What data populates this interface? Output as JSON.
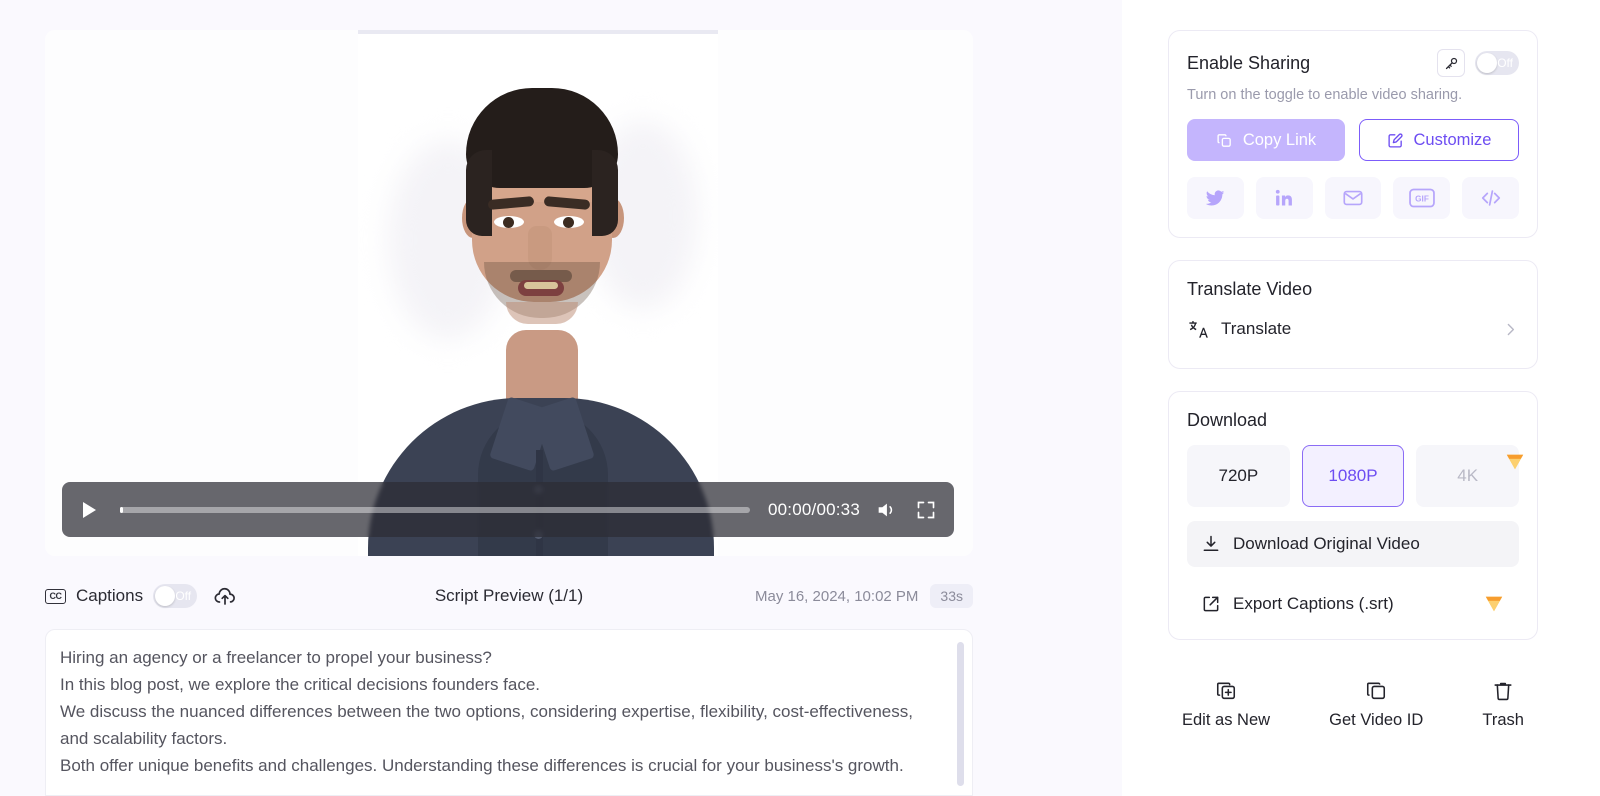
{
  "video": {
    "player": {
      "play_label": "play",
      "time": "00:00/00:33",
      "progress_percent": 0.5,
      "volume_icon": "volume-icon",
      "fullscreen_icon": "fullscreen-icon"
    },
    "meta": {
      "captions_label": "Captions",
      "captions_toggle_state": "Off",
      "cc_badge": "CC",
      "upload_icon": "cloud-upload-icon",
      "script_preview_title": "Script Preview (1/1)",
      "date": "May 16, 2024, 10:02 PM",
      "duration_badge": "33s"
    },
    "script_lines": [
      "Hiring an agency or a freelancer to propel your business?",
      "In this blog post, we explore the critical decisions founders face.",
      "We discuss the nuanced differences between the two options, considering expertise, flexibility, cost-effectiveness, and scalability factors.",
      "Both offer unique benefits and challenges. Understanding these differences is crucial for your business's growth."
    ]
  },
  "sharing": {
    "title": "Enable Sharing",
    "key_icon": "key-icon",
    "toggle_state": "Off",
    "subtitle": "Turn on the toggle to enable video sharing.",
    "copy_link_label": "Copy Link",
    "customize_label": "Customize",
    "social_icons": [
      "twitter-icon",
      "linkedin-icon",
      "email-icon",
      "gif-icon",
      "embed-code-icon"
    ]
  },
  "translate": {
    "title": "Translate Video",
    "item_label": "Translate",
    "item_icon": "translate-icon",
    "chevron": "chevron-right-icon"
  },
  "download": {
    "title": "Download",
    "qualities": [
      {
        "label": "720P",
        "state": "default"
      },
      {
        "label": "1080P",
        "state": "selected"
      },
      {
        "label": "4K",
        "state": "locked"
      }
    ],
    "original_label": "Download Original Video",
    "original_icon": "download-icon",
    "captions_label": "Export Captions (.srt)",
    "captions_icon": "external-link-icon",
    "premium_icon": "gem-icon"
  },
  "bottom_actions": [
    {
      "label": "Edit as New",
      "icon": "edit-as-new-icon"
    },
    {
      "label": "Get Video ID",
      "icon": "copy-icon"
    },
    {
      "label": "Trash",
      "icon": "trash-icon"
    }
  ],
  "colors": {
    "accent": "#6d4df2",
    "accent_soft": "#c4b5fd",
    "page_bg": "#faf9fe",
    "premium": "#f7a93b"
  }
}
